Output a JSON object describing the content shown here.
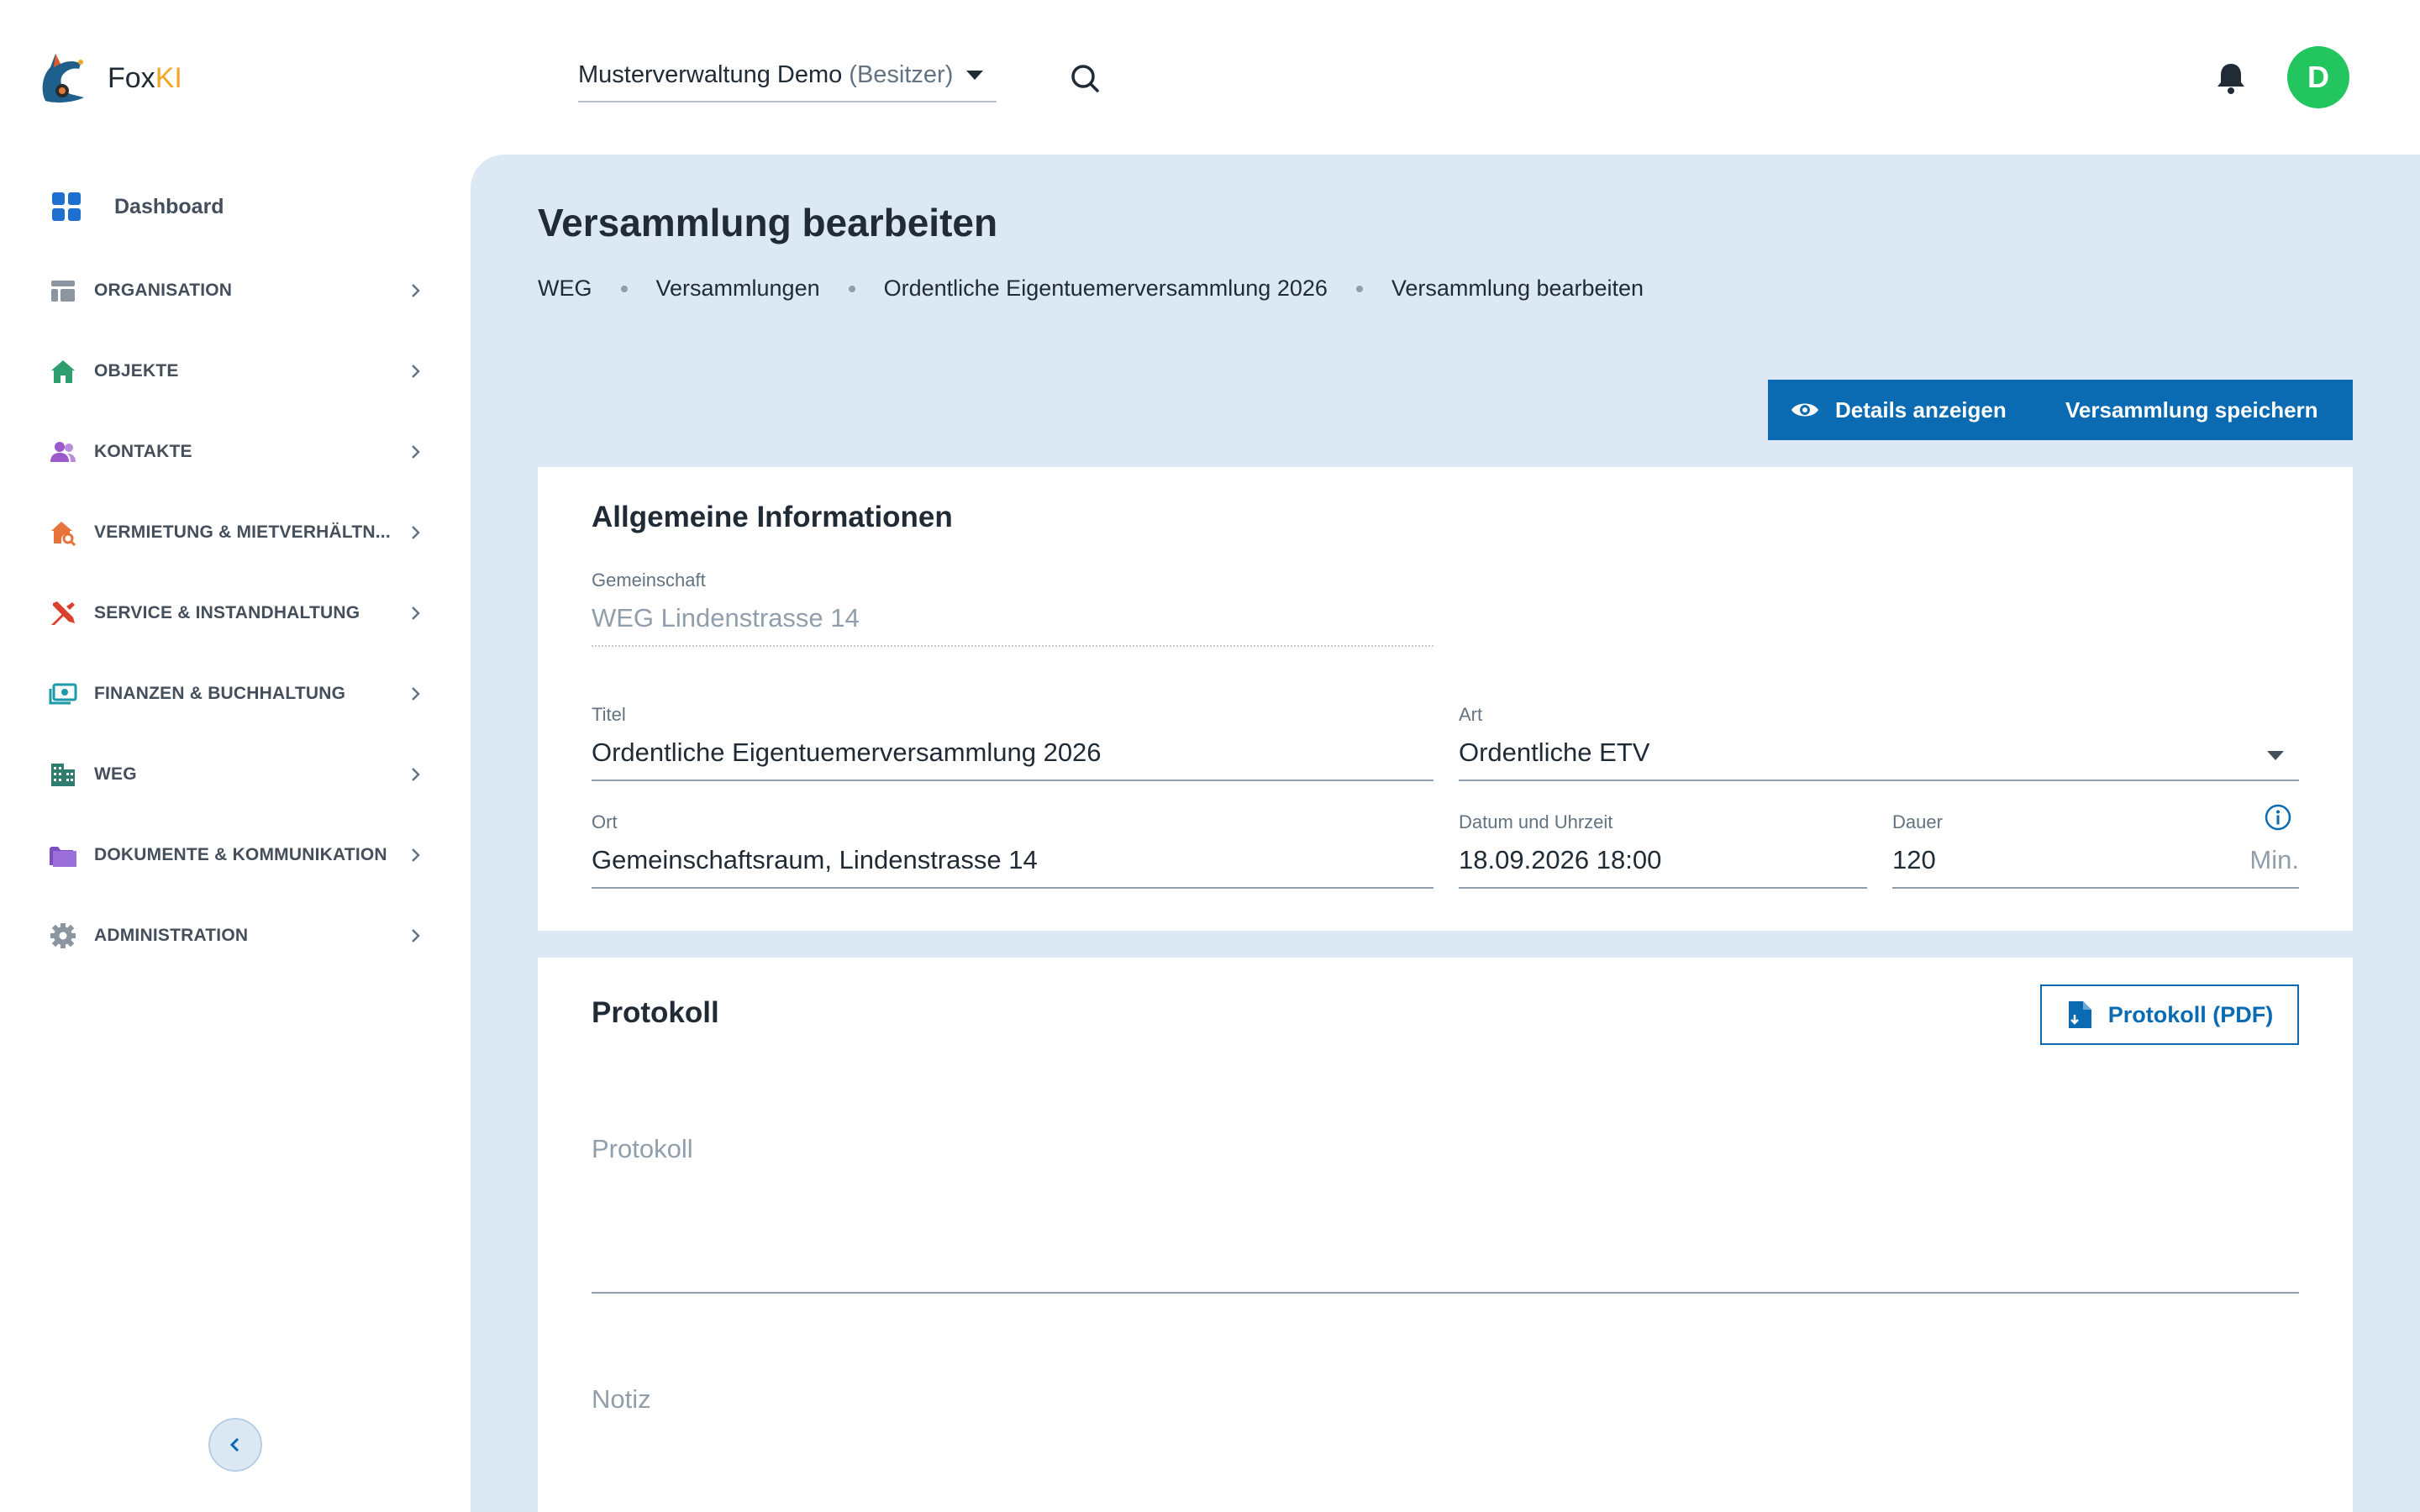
{
  "app": {
    "brand_prefix": "Fox",
    "brand_suffix": "KI"
  },
  "header": {
    "org_name": "Musterverwaltung Demo",
    "org_role": "(Besitzer)",
    "avatar_initial": "D"
  },
  "sidebar": {
    "dashboard_label": "Dashboard",
    "items": [
      {
        "label": "ORGANISATION",
        "icon": "organisation-icon"
      },
      {
        "label": "OBJEKTE",
        "icon": "house-icon"
      },
      {
        "label": "KONTAKTE",
        "icon": "people-icon"
      },
      {
        "label": "VERMIETUNG & MIETVERHÄLTN...",
        "icon": "house-search-icon"
      },
      {
        "label": "SERVICE & INSTANDHALTUNG",
        "icon": "tools-icon"
      },
      {
        "label": "FINANZEN & BUCHHALTUNG",
        "icon": "money-icon"
      },
      {
        "label": "WEG",
        "icon": "building-icon"
      },
      {
        "label": "DOKUMENTE & KOMMUNIKATION",
        "icon": "folder-icon"
      },
      {
        "label": "ADMINISTRATION",
        "icon": "gear-icon"
      }
    ]
  },
  "page": {
    "title": "Versammlung bearbeiten",
    "breadcrumb": [
      "WEG",
      "Versammlungen",
      "Ordentliche Eigentuemerversammlung 2026",
      "Versammlung bearbeiten"
    ]
  },
  "actions": {
    "details_label": "Details anzeigen",
    "save_label": "Versammlung speichern"
  },
  "general": {
    "title": "Allgemeine Informationen",
    "gemeinschaft_label": "Gemeinschaft",
    "gemeinschaft_value": "WEG Lindenstrasse 14",
    "titel_label": "Titel",
    "titel_value": "Ordentliche Eigentuemerversammlung 2026",
    "art_label": "Art",
    "art_value": "Ordentliche ETV",
    "ort_label": "Ort",
    "ort_value": "Gemeinschaftsraum, Lindenstrasse 14",
    "datum_label": "Datum und Uhrzeit",
    "datum_value": "18.09.2026 18:00",
    "dauer_label": "Dauer",
    "dauer_value": "120",
    "dauer_unit": "Min."
  },
  "protokoll": {
    "title": "Protokoll",
    "pdf_label": "Protokoll (PDF)",
    "protokoll_placeholder": "Protokoll",
    "notiz_placeholder": "Notiz"
  },
  "colors": {
    "primary": "#0a6ab2",
    "main_bg": "#dce9f5",
    "avatar": "#22c55e",
    "brand_accent": "#f5a623"
  }
}
